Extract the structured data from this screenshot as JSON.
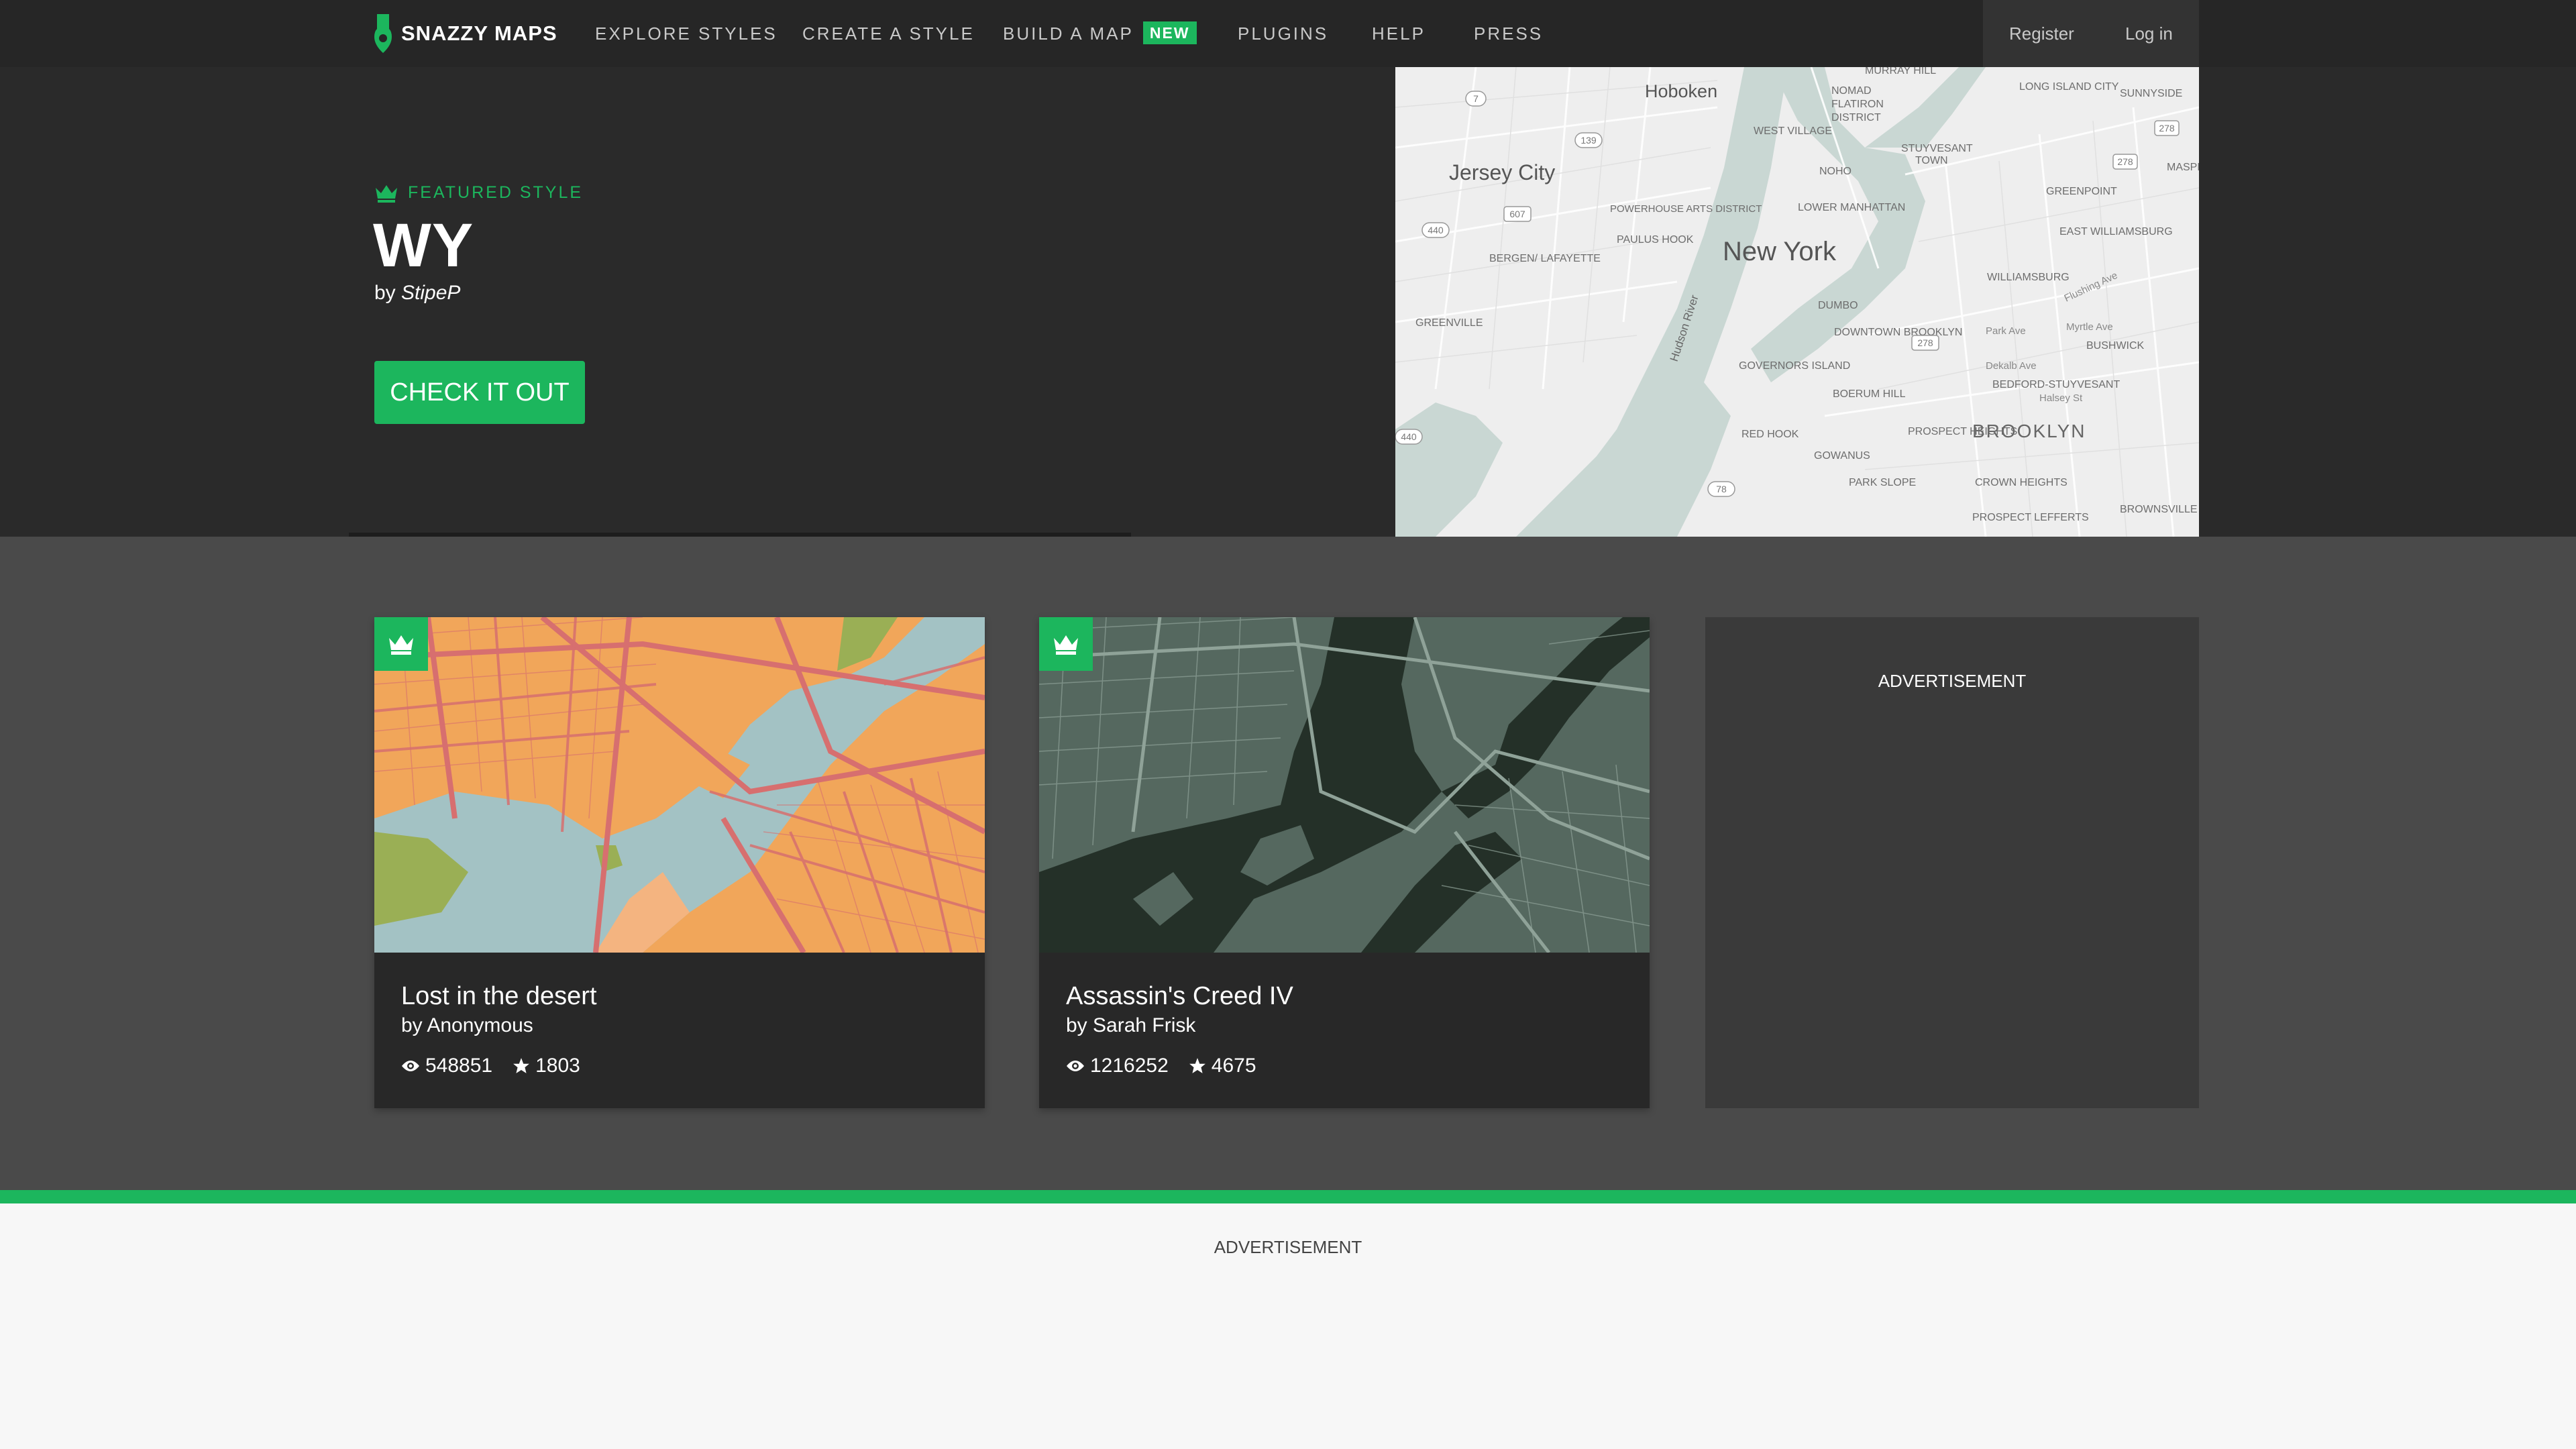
{
  "nav": {
    "logo_text": "SNAZZY MAPS",
    "items": [
      {
        "label": "EXPLORE STYLES"
      },
      {
        "label": "CREATE A STYLE"
      },
      {
        "label": "BUILD A MAP",
        "badge": "NEW"
      },
      {
        "label": "PLUGINS"
      },
      {
        "label": "HELP"
      },
      {
        "label": "PRESS"
      }
    ],
    "register": "Register",
    "login": "Log in"
  },
  "hero": {
    "featured_label": "FEATURED STYLE",
    "title": "WY",
    "by_prefix": "by",
    "author": "StipeP",
    "cta": "CHECK IT OUT",
    "map_labels": {
      "hoboken": "Hoboken",
      "jersey_city": "Jersey City",
      "new_york": "New York",
      "brooklyn": "BROOKLYN",
      "nomad": "NOMAD",
      "flatiron": "FLATIRON",
      "district": "DISTRICT",
      "murray_hill": "MURRAY HILL",
      "west_village": "WEST VILLAGE",
      "stuyvesant": "STUYVESANT",
      "town": "TOWN",
      "long_island_city": "LONG ISLAND CITY",
      "sunnyside": "SUNNYSIDE",
      "maspeth": "MASPETH",
      "greenpoint": "GREENPOINT",
      "east_williamsburg": "EAST WILLIAMSBURG",
      "williamsburg": "WILLIAMSBURG",
      "noho": "NOHO",
      "lower_manhattan": "LOWER MANHATTAN",
      "powerhouse": "POWERHOUSE ARTS DISTRICT",
      "paulus_hook": "PAULUS HOOK",
      "bergen": "BERGEN/ LAFAYETTE",
      "greenville": "GREENVILLE",
      "dumbo": "DUMBO",
      "downtown_brooklyn": "DOWNTOWN BROOKLYN",
      "governors_island": "GOVERNORS ISLAND",
      "boerum_hill": "BOERUM HILL",
      "bedford": "BEDFORD-STUYVESANT",
      "bushwick": "BUSHWICK",
      "red_hook": "RED HOOK",
      "prospect_heights": "PROSPECT HEIGHTS",
      "gowanus": "GOWANUS",
      "park_slope": "PARK SLOPE",
      "crown_heights": "CROWN HEIGHTS",
      "prospect_lefferts": "PROSPECT LEFFERTS",
      "brownsville": "BROWNSVILLE",
      "hudson_river": "Hudson River",
      "park_ave": "Park Ave",
      "myrtle_ave": "Myrtle Ave",
      "dekalb_ave": "Dekalb Ave",
      "halsey_st": "Halsey St",
      "flushing_ave": "Flushing Ave",
      "r7": "7",
      "r139": "139",
      "r78": "78",
      "r607": "607",
      "r440a": "440",
      "r440b": "440",
      "r278a": "278",
      "r278b": "278",
      "r278c": "278"
    }
  },
  "cards": [
    {
      "title": "Lost in the desert",
      "author": "by Anonymous",
      "views": "548851",
      "stars": "1803"
    },
    {
      "title": "Assassin's Creed IV",
      "author": "by Sarah Frisk",
      "views": "1216252",
      "stars": "4675"
    }
  ],
  "ads": {
    "side_label": "ADVERTISEMENT",
    "bottom_label": "ADVERTISEMENT"
  },
  "colors": {
    "accent": "#1cb65d",
    "nav_bg": "#262626",
    "hero_bg": "#2a2a2a",
    "content_bg": "#4a4a4a"
  },
  "icons": {
    "logo": "map-pin-icon",
    "featured": "crown-icon",
    "card_badge": "crown-icon",
    "views": "eye-icon",
    "stars": "star-icon"
  }
}
